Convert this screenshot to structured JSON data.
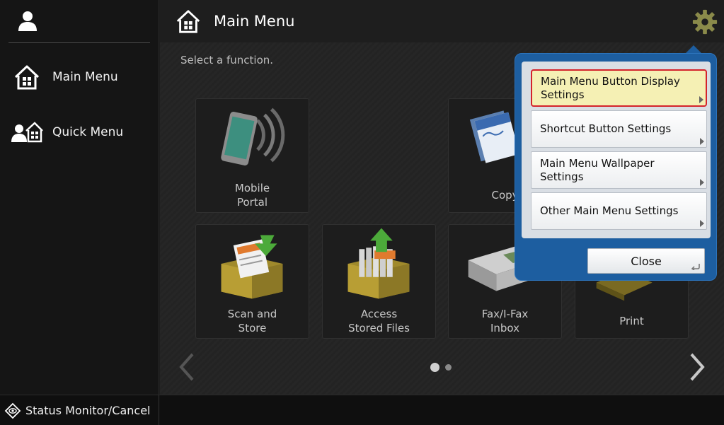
{
  "header": {
    "title": "Main Menu"
  },
  "sidebar": {
    "items": [
      {
        "label": "Main Menu",
        "icon": "home-icon"
      },
      {
        "label": "Quick Menu",
        "icon": "quick-menu-icon"
      }
    ]
  },
  "content": {
    "instruction": "Select a function.",
    "tiles": [
      {
        "label_lines": [
          "Mobile",
          "Portal"
        ],
        "icon": "mobile-portal-icon"
      },
      {
        "label_lines": [
          "Copy"
        ],
        "icon": "copy-icon"
      },
      {
        "label_lines": [
          "Scan and",
          "Store"
        ],
        "icon": "scan-store-icon"
      },
      {
        "label_lines": [
          "Access",
          "Stored Files"
        ],
        "icon": "access-files-icon"
      },
      {
        "label_lines": [
          "Fax/I-Fax",
          "Inbox"
        ],
        "icon": "fax-inbox-icon"
      },
      {
        "label_lines": [
          "Print"
        ],
        "icon": "print-icon"
      }
    ],
    "pagination": {
      "current": 1,
      "total": 2
    }
  },
  "popup": {
    "items": [
      {
        "label_lines": [
          "Main Menu Button Display",
          "Settings"
        ],
        "selected": true
      },
      {
        "label_lines": [
          "Shortcut Button Settings"
        ],
        "selected": false
      },
      {
        "label_lines": [
          "Main Menu Wallpaper Settings"
        ],
        "selected": false
      },
      {
        "label_lines": [
          "Other Main Menu Settings"
        ],
        "selected": false
      }
    ],
    "close_label": "Close"
  },
  "statusbar": {
    "label": "Status Monitor/Cancel"
  },
  "colors": {
    "popup_blue": "#1d5ea0",
    "selected_fill": "#f5f0b4",
    "selected_border": "#d4232b"
  }
}
